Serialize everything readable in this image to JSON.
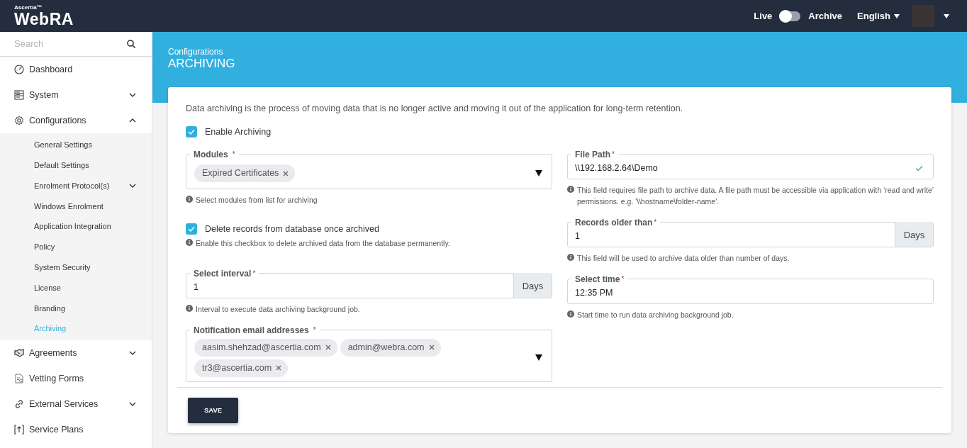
{
  "header": {
    "brand_small": "Ascertia™",
    "brand_name": "WebRA",
    "live_label": "Live",
    "live_toggle": {
      "on": false
    },
    "archive_label": "Archive",
    "language": "English"
  },
  "sidebar": {
    "search": {
      "placeholder": "Search"
    },
    "items": [
      {
        "label": "Dashboard",
        "selected": false
      },
      {
        "label": "System",
        "selected": false,
        "expanded": false
      },
      {
        "label": "Configurations",
        "selected": false,
        "expanded": true,
        "children": [
          {
            "label": "General Settings",
            "selected": false
          },
          {
            "label": "Default Settings",
            "selected": false
          },
          {
            "label": "Enrolment Protocol(s)",
            "selected": false,
            "expanded": false
          },
          {
            "label": "Windows Enrolment",
            "selected": false
          },
          {
            "label": "Application Integration",
            "selected": false
          },
          {
            "label": "Policy",
            "selected": false
          },
          {
            "label": "System Security",
            "selected": false
          },
          {
            "label": "License",
            "selected": false
          },
          {
            "label": "Branding",
            "selected": false
          },
          {
            "label": "Archiving",
            "selected": true
          }
        ]
      },
      {
        "label": "Agreements",
        "selected": false,
        "expanded": false
      },
      {
        "label": "Vetting Forms",
        "selected": false
      },
      {
        "label": "External Services",
        "selected": false,
        "expanded": false
      },
      {
        "label": "Service Plans",
        "selected": false
      }
    ]
  },
  "page": {
    "breadcrumb": "Configurations",
    "title": "ARCHIVING"
  },
  "form": {
    "description": "Data archiving is the process of moving data that is no longer active and moving it out of the application for long-term retention.",
    "enable": {
      "label": "Enable Archiving",
      "checked": true
    },
    "left_fields": [
      {
        "kind": "chips",
        "label": "Modules",
        "required_mark": "*",
        "chips": [
          "Expired Certificates"
        ],
        "hint": "Select modules from list for archiving"
      },
      {
        "kind": "checkbox",
        "label": "Delete records from database once archived",
        "checked": true,
        "hint": "Enable this checkbox to delete archived data from the database permanently."
      },
      {
        "kind": "addon",
        "label": "Select interval",
        "required_mark": "*",
        "value": "1",
        "addon": "Days",
        "hint": "Interval to execute data archiving background job."
      },
      {
        "kind": "chips",
        "label": "Notification email addresses",
        "required_mark": "*",
        "chips": [
          "aasim.shehzad@ascertia.com",
          "admin@webra.com",
          "tr3@ascertia.com"
        ]
      }
    ],
    "right_fields": [
      {
        "kind": "text",
        "label": "File Path",
        "required_mark": "*",
        "value": "\\\\192.168.2.64\\Demo",
        "valid": true,
        "hint": "This field requires file path to archive data. A file path must be accessible via application with ‘read and write’ permissions. e.g. '\\\\hostname\\folder-name'."
      },
      {
        "kind": "addon",
        "label": "Records older than",
        "required_mark": "*",
        "value": "1",
        "addon": "Days",
        "hint": "This field will be used to archive data older than number of days."
      },
      {
        "kind": "text",
        "label": "Select time",
        "required_mark": "*",
        "value": "12:35 PM",
        "hint": "Start time to run data archiving background job."
      }
    ],
    "save_button": "SAVE"
  }
}
